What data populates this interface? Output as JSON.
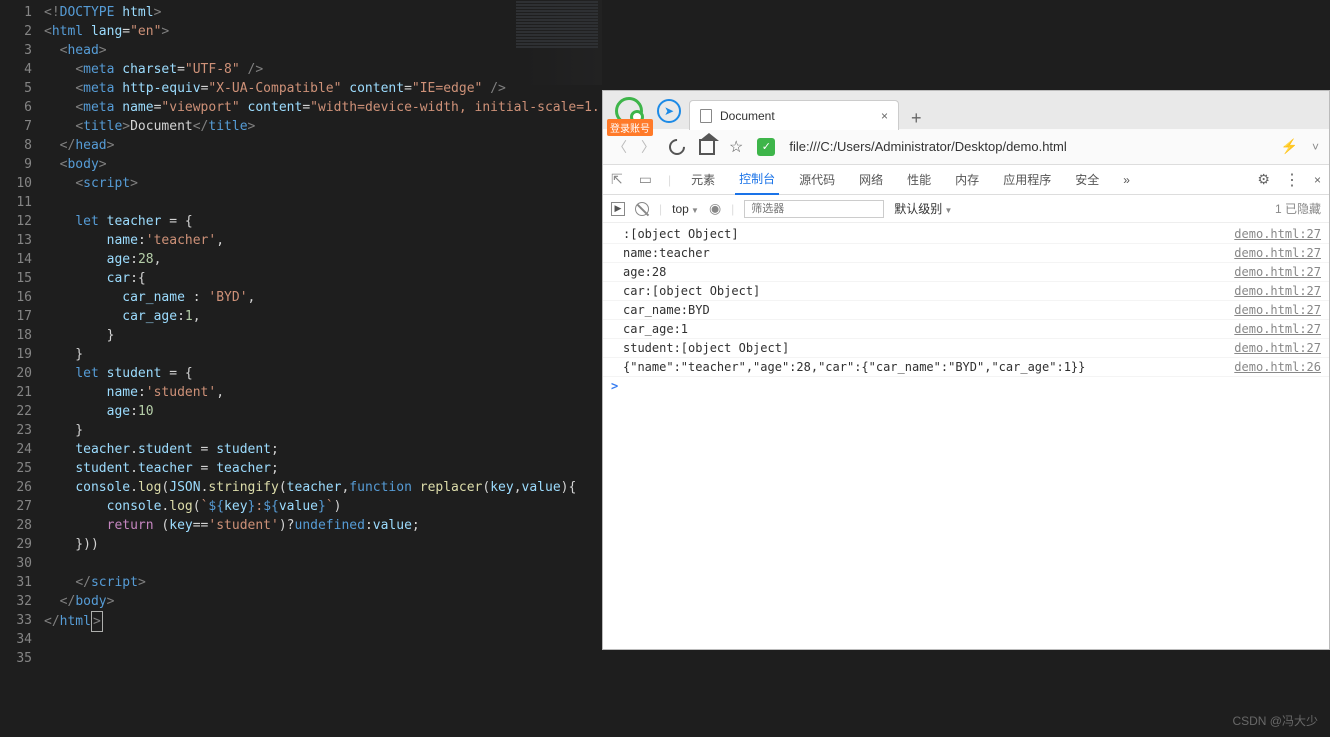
{
  "editor": {
    "lines": 35,
    "code": [
      {
        "i": 1,
        "html": "<span class='t-ang'>&lt;!</span><span class='t-tag'>DOCTYPE</span> <span class='t-attr'>html</span><span class='t-ang'>&gt;</span>"
      },
      {
        "i": 2,
        "html": "<span class='t-ang'>&lt;</span><span class='t-tag'>html</span> <span class='t-attr'>lang</span>=<span class='t-str'>\"en\"</span><span class='t-ang'>&gt;</span>"
      },
      {
        "i": 3,
        "html": "  <span class='t-ang'>&lt;</span><span class='t-tag'>head</span><span class='t-ang'>&gt;</span>"
      },
      {
        "i": 4,
        "html": "    <span class='t-ang'>&lt;</span><span class='t-tag'>meta</span> <span class='t-attr'>charset</span>=<span class='t-str'>\"UTF-8\"</span> <span class='t-ang'>/&gt;</span>"
      },
      {
        "i": 5,
        "html": "    <span class='t-ang'>&lt;</span><span class='t-tag'>meta</span> <span class='t-attr'>http-equiv</span>=<span class='t-str'>\"X-UA-Compatible\"</span> <span class='t-attr'>content</span>=<span class='t-str'>\"IE=edge\"</span> <span class='t-ang'>/&gt;</span>"
      },
      {
        "i": 6,
        "html": "    <span class='t-ang'>&lt;</span><span class='t-tag'>meta</span> <span class='t-attr'>name</span>=<span class='t-str'>\"viewport\"</span> <span class='t-attr'>content</span>=<span class='t-str'>\"width=device-width, initial-scale=1.</span>"
      },
      {
        "i": 7,
        "html": "    <span class='t-ang'>&lt;</span><span class='t-tag'>title</span><span class='t-ang'>&gt;</span><span class='t-txt'>Document</span><span class='t-ang'>&lt;/</span><span class='t-tag'>title</span><span class='t-ang'>&gt;</span>"
      },
      {
        "i": 8,
        "html": "  <span class='t-ang'>&lt;/</span><span class='t-tag'>head</span><span class='t-ang'>&gt;</span>"
      },
      {
        "i": 9,
        "html": "  <span class='t-ang'>&lt;</span><span class='t-tag'>body</span><span class='t-ang'>&gt;</span>"
      },
      {
        "i": 10,
        "html": "    <span class='t-ang'>&lt;</span><span class='t-tag'>script</span><span class='t-ang'>&gt;</span>"
      },
      {
        "i": 11,
        "html": ""
      },
      {
        "i": 12,
        "html": "    <span class='t-kw'>let</span> <span class='t-var'>teacher</span> = {"
      },
      {
        "i": 13,
        "html": "        <span class='t-prop'>name</span>:<span class='t-str'>'teacher'</span>,"
      },
      {
        "i": 14,
        "html": "        <span class='t-prop'>age</span>:<span class='t-num'>28</span>,"
      },
      {
        "i": 15,
        "html": "        <span class='t-prop'>car</span>:{"
      },
      {
        "i": 16,
        "html": "          <span class='t-prop'>car_name</span> : <span class='t-str'>'BYD'</span>,"
      },
      {
        "i": 17,
        "html": "          <span class='t-prop'>car_age</span>:<span class='t-num'>1</span>,"
      },
      {
        "i": 18,
        "html": "        }"
      },
      {
        "i": 19,
        "html": "    }"
      },
      {
        "i": 20,
        "html": "    <span class='t-kw'>let</span> <span class='t-var'>student</span> = {"
      },
      {
        "i": 21,
        "html": "        <span class='t-prop'>name</span>:<span class='t-str'>'student'</span>,"
      },
      {
        "i": 22,
        "html": "        <span class='t-prop'>age</span>:<span class='t-num'>10</span>"
      },
      {
        "i": 23,
        "html": "    }"
      },
      {
        "i": 24,
        "html": "    <span class='t-var'>teacher</span>.<span class='t-var'>student</span> = <span class='t-var'>student</span>;"
      },
      {
        "i": 25,
        "html": "    <span class='t-var'>student</span>.<span class='t-var'>teacher</span> = <span class='t-var'>teacher</span>;"
      },
      {
        "i": 26,
        "html": "    <span class='t-var'>console</span>.<span class='t-fn'>log</span>(<span class='t-var'>JSON</span>.<span class='t-fn'>stringify</span>(<span class='t-var'>teacher</span>,<span class='t-kw'>function</span> <span class='t-fn'>replacer</span>(<span class='t-var'>key</span>,<span class='t-var'>value</span>){"
      },
      {
        "i": 27,
        "html": "        <span class='t-var'>console</span>.<span class='t-fn'>log</span>(<span class='t-tplstr'>`</span><span class='t-tplexp'>${</span><span class='t-var'>key</span><span class='t-tplexp'>}</span><span class='t-tplstr'>:</span><span class='t-tplexp'>${</span><span class='t-var'>value</span><span class='t-tplexp'>}</span><span class='t-tplstr'>`</span>)"
      },
      {
        "i": 28,
        "html": "        <span class='t-kw2'>return</span> (<span class='t-var'>key</span>==<span class='t-str'>'student'</span>)?<span class='t-kw'>undefined</span>:<span class='t-var'>value</span>;"
      },
      {
        "i": 29,
        "html": "    }))"
      },
      {
        "i": 30,
        "html": ""
      },
      {
        "i": 31,
        "html": "    <span class='t-ang'>&lt;/</span><span class='t-tag'>script</span><span class='t-ang'>&gt;</span>"
      },
      {
        "i": 32,
        "html": "  <span class='t-ang'>&lt;/</span><span class='t-tag'>body</span><span class='t-ang'>&gt;</span>"
      },
      {
        "i": 33,
        "html": "<span class='t-ang'>&lt;/</span><span class='t-tag'>html</span><span class='cursor-box'><span class='t-ang'>&gt;</span></span>"
      },
      {
        "i": 34,
        "html": ""
      },
      {
        "i": 35,
        "html": ""
      }
    ]
  },
  "browser": {
    "login_badge": "登录账号",
    "tab_title": "Document",
    "url": "file:///C:/Users/Administrator/Desktop/demo.html"
  },
  "devtools": {
    "tabs": [
      "元素",
      "控制台",
      "源代码",
      "网络",
      "性能",
      "内存",
      "应用程序",
      "安全"
    ],
    "active_tab": "控制台",
    "more": "»",
    "context": "top",
    "filter_placeholder": "筛选器",
    "level": "默认级别",
    "hidden": "1 已隐藏",
    "console": [
      {
        "msg": ":[object Object]",
        "src": "demo.html:27"
      },
      {
        "msg": "name:teacher",
        "src": "demo.html:27"
      },
      {
        "msg": "age:28",
        "src": "demo.html:27"
      },
      {
        "msg": "car:[object Object]",
        "src": "demo.html:27"
      },
      {
        "msg": "car_name:BYD",
        "src": "demo.html:27"
      },
      {
        "msg": "car_age:1",
        "src": "demo.html:27"
      },
      {
        "msg": "student:[object Object]",
        "src": "demo.html:27"
      },
      {
        "msg": "{\"name\":\"teacher\",\"age\":28,\"car\":{\"car_name\":\"BYD\",\"car_age\":1}}",
        "src": "demo.html:26"
      }
    ]
  },
  "watermark": "CSDN @冯大少"
}
